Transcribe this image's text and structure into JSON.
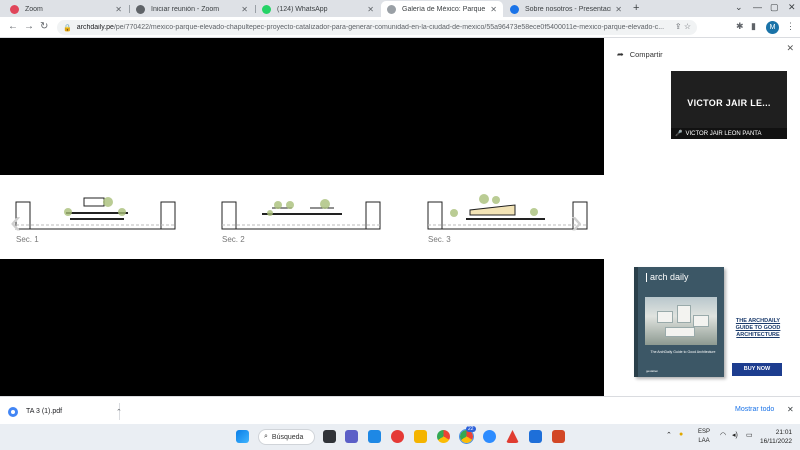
{
  "browser": {
    "tabs": [
      {
        "label": "Zoom",
        "fav_color": "#e0455a",
        "active": false
      },
      {
        "label": "Iniciar reunión - Zoom",
        "fav_color": "#5f6368",
        "active": false
      },
      {
        "label": "(124) WhatsApp",
        "fav_color": "#25d366",
        "active": false
      },
      {
        "label": "Galería de México: Parque Elevad",
        "fav_color": "#9aa0a6",
        "active": true
      },
      {
        "label": "Sobre nosotros - Presentación",
        "fav_color": "#1a73e8",
        "active": false
      }
    ],
    "url_host": "archdaily.pe",
    "url_path": "/pe/770422/mexico-parque-elevado-chapultepec-proyecto-catalizador-para-generar-comunidad-en-la-ciudad-de-mexico/55a96473e58ece0f5400011e-mexico-parque-elevado-c...",
    "profile_initial": "M"
  },
  "gallery": {
    "sections": [
      "Sec. 1",
      "Sec. 2",
      "Sec. 3"
    ]
  },
  "side": {
    "share_label": "Compartir",
    "zoom_name": "VICTOR JAIR LE...",
    "zoom_full_name": "VICTOR JAIR LEON PANTA",
    "ad": {
      "logo": "arch daily",
      "book_title": "The ArchDaily Guide to Good Architecture",
      "book_publisher": "gestalten",
      "headline": "THE ARCHDAILY GUIDE TO GOOD ARCHITECTURE",
      "buy_label": "BUY NOW"
    }
  },
  "downloads": {
    "file": "TA 3 (1).pdf",
    "show_all": "Mostrar todo"
  },
  "taskbar": {
    "search_label": "Búsqueda",
    "lang_line1": "ESP",
    "lang_line2": "LAA",
    "time": "21:01",
    "date": "16/11/2022",
    "chrome_badge": "22"
  }
}
